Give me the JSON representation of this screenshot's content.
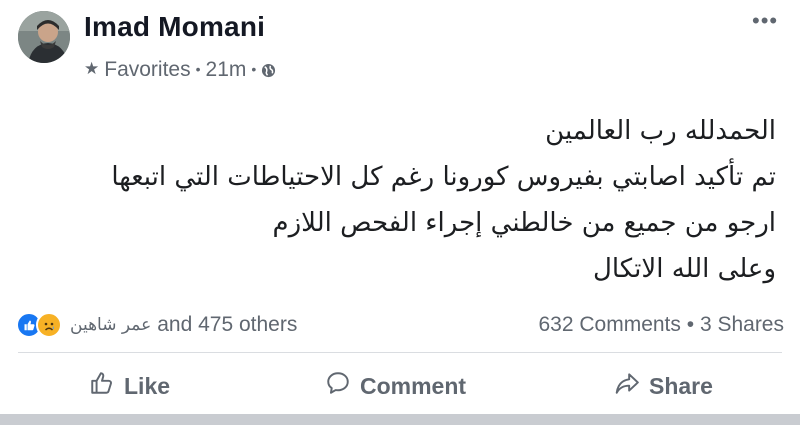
{
  "post": {
    "author": "Imad Momani",
    "audience": "Favorites",
    "time": "21m",
    "body_lines": [
      "الحمدلله رب العالمين",
      "تم تأكيد اصابتي بفيروس كورونا رغم كل الاحتياطات التي اتبعها",
      "ارجو من جميع من خالطني إجراء الفحص اللازم",
      "وعلى الله الاتكال"
    ]
  },
  "stats": {
    "reactor_name": "عمر شاهين",
    "others": "and 475 others",
    "comments": "632 Comments",
    "shares": "3 Shares"
  },
  "actions": {
    "like": "Like",
    "comment": "Comment",
    "share": "Share"
  },
  "colors": {
    "like_blue": "#1877f2",
    "sad_yellow": "#f7b125",
    "meta_gray": "#606770"
  },
  "icons": {
    "audience": "star-icon",
    "privacy": "globe-icon",
    "more": "more-options-icon",
    "like": "thumbs-up-icon",
    "comment": "comment-bubble-icon",
    "share": "share-arrow-icon"
  }
}
